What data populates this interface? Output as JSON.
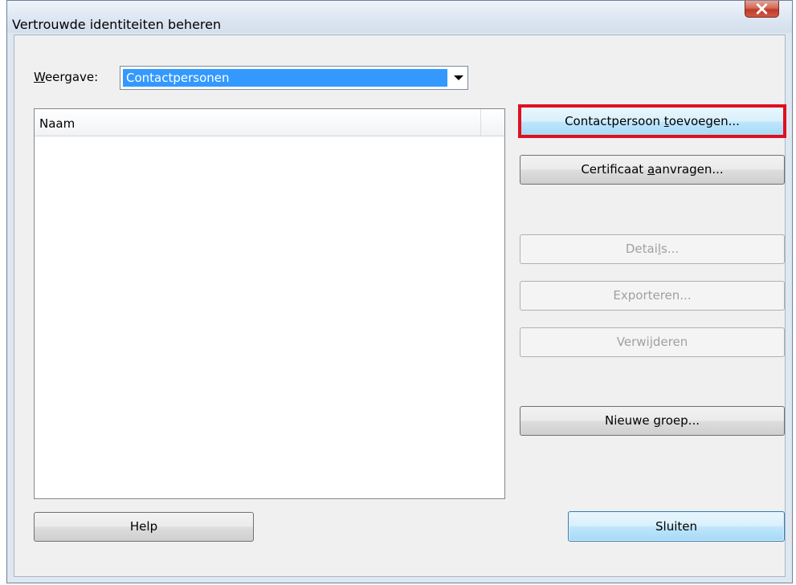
{
  "window": {
    "title": "Vertrouwde identiteiten beheren",
    "close_icon": "close-icon",
    "close_color": "#c0392b"
  },
  "view": {
    "label_mnemonic": "W",
    "label_rest": "eergave:",
    "selected": "Contactpersonen",
    "dropdown_icon": "chevron-down-icon"
  },
  "list": {
    "columns": [
      "Naam"
    ],
    "rows": []
  },
  "buttons": {
    "add_contact": {
      "pre": "Contactpersoon ",
      "mn": "t",
      "post": "oevoegen...",
      "enabled": true,
      "highlighted": true
    },
    "request_cert": {
      "pre": "Certificaat ",
      "mn": "a",
      "post": "anvragen...",
      "enabled": true
    },
    "details": {
      "pre": "Detai",
      "mn": "l",
      "post": "s...",
      "enabled": false
    },
    "export": {
      "label": "Exporteren...",
      "enabled": false
    },
    "delete": {
      "label": "Verwijderen",
      "enabled": false
    },
    "new_group": {
      "pre": "Nieuwe ",
      "mn": "g",
      "post": "roep...",
      "enabled": true
    },
    "help": {
      "label": "Help",
      "enabled": true
    },
    "close": {
      "label": "Sluiten",
      "enabled": true,
      "default": true
    }
  },
  "colors": {
    "highlight_annotation": "#e0101e",
    "selection": "#3399ff"
  }
}
